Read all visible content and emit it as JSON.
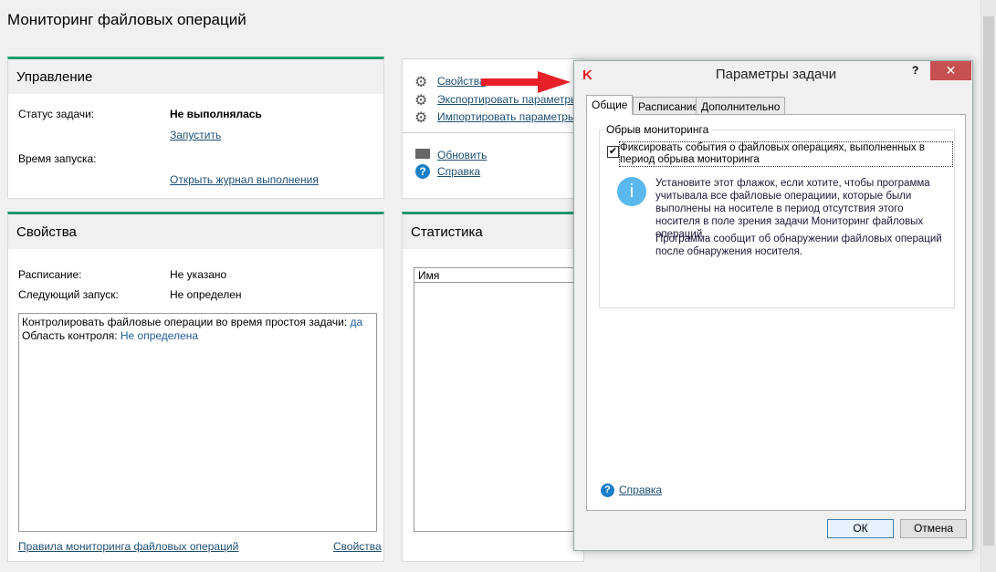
{
  "page_title": "Мониторинг файловых операций",
  "control": {
    "title": "Управление",
    "status_label": "Статус задачи:",
    "status_value": "Не выполнялась",
    "run_link": "Запустить",
    "start_label": "Время запуска:",
    "log_link": "Открыть журнал выполнения"
  },
  "props": {
    "title": "Свойства",
    "schedule_label": "Расписание:",
    "schedule_value": "Не указано",
    "next_label": "Следующий запуск:",
    "next_value": "Не определен",
    "line1_text": "Контролировать файловые операции во время простоя задачи: ",
    "line1_value": "да",
    "line2_text": "Область контроля: ",
    "line2_value": "Не определена",
    "rules_link": "Правила мониторинга файловых операций",
    "props_link": "Свойства"
  },
  "actions": {
    "properties": "Свойства",
    "export": "Экспортировать параметры",
    "import": "Импортировать параметры",
    "refresh": "Обновить",
    "help": "Справка"
  },
  "stats": {
    "title": "Статистика",
    "col_name": "Имя"
  },
  "dialog": {
    "title": "Параметры задачи",
    "help_btn": "?",
    "tabs": [
      "Общие",
      "Расписание",
      "Дополнительно"
    ],
    "group_title": "Обрыв мониторинга",
    "checkbox_label": "Фиксировать события о файловых операциях, выполненных в период обрыва мониторинга",
    "checkbox_checked": true,
    "info1": "Установите этот флажок, если хотите, чтобы программа учитывала все файловые операциии, которые были выполнены на носителе в период отсутствия этого носителя в поле зрения задачи Мониторинг файловых операций.",
    "info2": "Программа сообщит об обнаружении файловых операций после обнаружения носителя.",
    "help_link": "Справка",
    "ok": "ОК",
    "cancel": "Отмена"
  },
  "colors": {
    "accent": "#1e9a6c",
    "close": "#c75050",
    "arrow": "#e8202a",
    "info": "#5bb8ee"
  }
}
